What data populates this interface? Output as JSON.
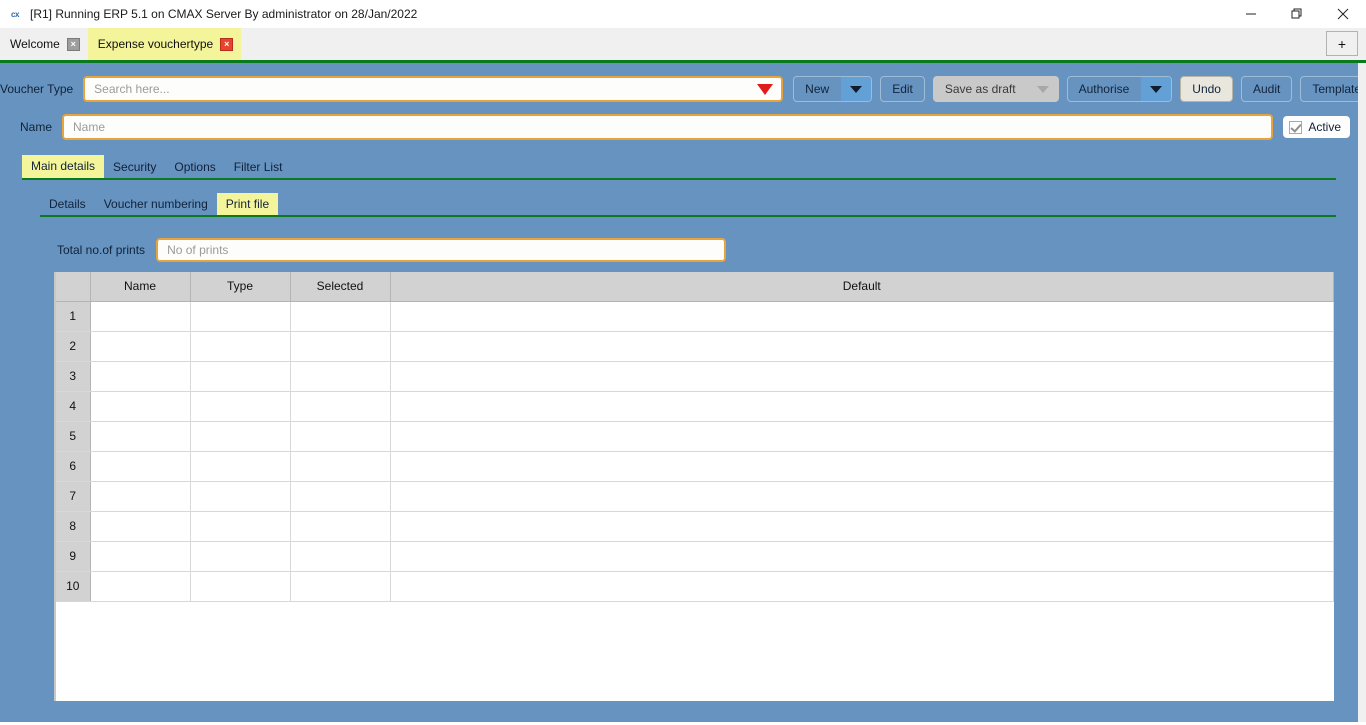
{
  "window": {
    "title": "[R1] Running ERP 5.1 on CMAX Server By administrator on 28/Jan/2022",
    "app_icon": "cx",
    "minimize": "minimize-icon",
    "maximize": "restore-icon",
    "close": "close-icon"
  },
  "tabs": [
    {
      "label": "Welcome",
      "active": false,
      "close": "×"
    },
    {
      "label": "Expense vouchertype",
      "active": true,
      "close": "×"
    }
  ],
  "tab_add_label": "+",
  "toolbar": {
    "voucher_type_label": "Voucher Type",
    "search_placeholder": "Search here...",
    "search_value": "",
    "buttons": [
      {
        "label": "New",
        "type": "split",
        "enabled": true
      },
      {
        "label": "Edit",
        "type": "plain",
        "enabled": true
      },
      {
        "label": "Save as draft",
        "type": "split",
        "enabled": false
      },
      {
        "label": "Authorise",
        "type": "split",
        "enabled": true
      },
      {
        "label": "Undo",
        "type": "plain-light",
        "enabled": true
      },
      {
        "label": "Audit",
        "type": "plain",
        "enabled": true
      },
      {
        "label": "Template",
        "type": "plain",
        "enabled": true
      }
    ]
  },
  "name_row": {
    "label": "Name",
    "placeholder": "Name",
    "value": "",
    "active_label": "Active",
    "active_checked": true
  },
  "tabs_level1": [
    {
      "label": "Main details",
      "active": true
    },
    {
      "label": "Security",
      "active": false
    },
    {
      "label": "Options",
      "active": false
    },
    {
      "label": "Filter List",
      "active": false
    }
  ],
  "tabs_level2": [
    {
      "label": "Details",
      "active": false
    },
    {
      "label": "Voucher numbering",
      "active": false
    },
    {
      "label": "Print file",
      "active": true
    }
  ],
  "print_file": {
    "total_prints_label": "Total no.of prints",
    "total_prints_placeholder": "No of prints",
    "total_prints_value": ""
  },
  "grid": {
    "columns": [
      "Name",
      "Type",
      "Selected",
      "Default"
    ],
    "rows": [
      {
        "num": "1",
        "name": "",
        "type": "",
        "selected": "",
        "default": ""
      },
      {
        "num": "2",
        "name": "",
        "type": "",
        "selected": "",
        "default": ""
      },
      {
        "num": "3",
        "name": "",
        "type": "",
        "selected": "",
        "default": ""
      },
      {
        "num": "4",
        "name": "",
        "type": "",
        "selected": "",
        "default": ""
      },
      {
        "num": "5",
        "name": "",
        "type": "",
        "selected": "",
        "default": ""
      },
      {
        "num": "6",
        "name": "",
        "type": "",
        "selected": "",
        "default": ""
      },
      {
        "num": "7",
        "name": "",
        "type": "",
        "selected": "",
        "default": ""
      },
      {
        "num": "8",
        "name": "",
        "type": "",
        "selected": "",
        "default": ""
      },
      {
        "num": "9",
        "name": "",
        "type": "",
        "selected": "",
        "default": ""
      },
      {
        "num": "10",
        "name": "",
        "type": "",
        "selected": "",
        "default": ""
      }
    ]
  },
  "colors": {
    "panel_blue": "#6693c0",
    "accent_orange": "#e8a33d",
    "active_tab_yellow": "#f4f59b",
    "rule_green": "#0a7a1e",
    "dropdown_red": "#e11b1b",
    "header_gray": "#d2d2d2"
  }
}
